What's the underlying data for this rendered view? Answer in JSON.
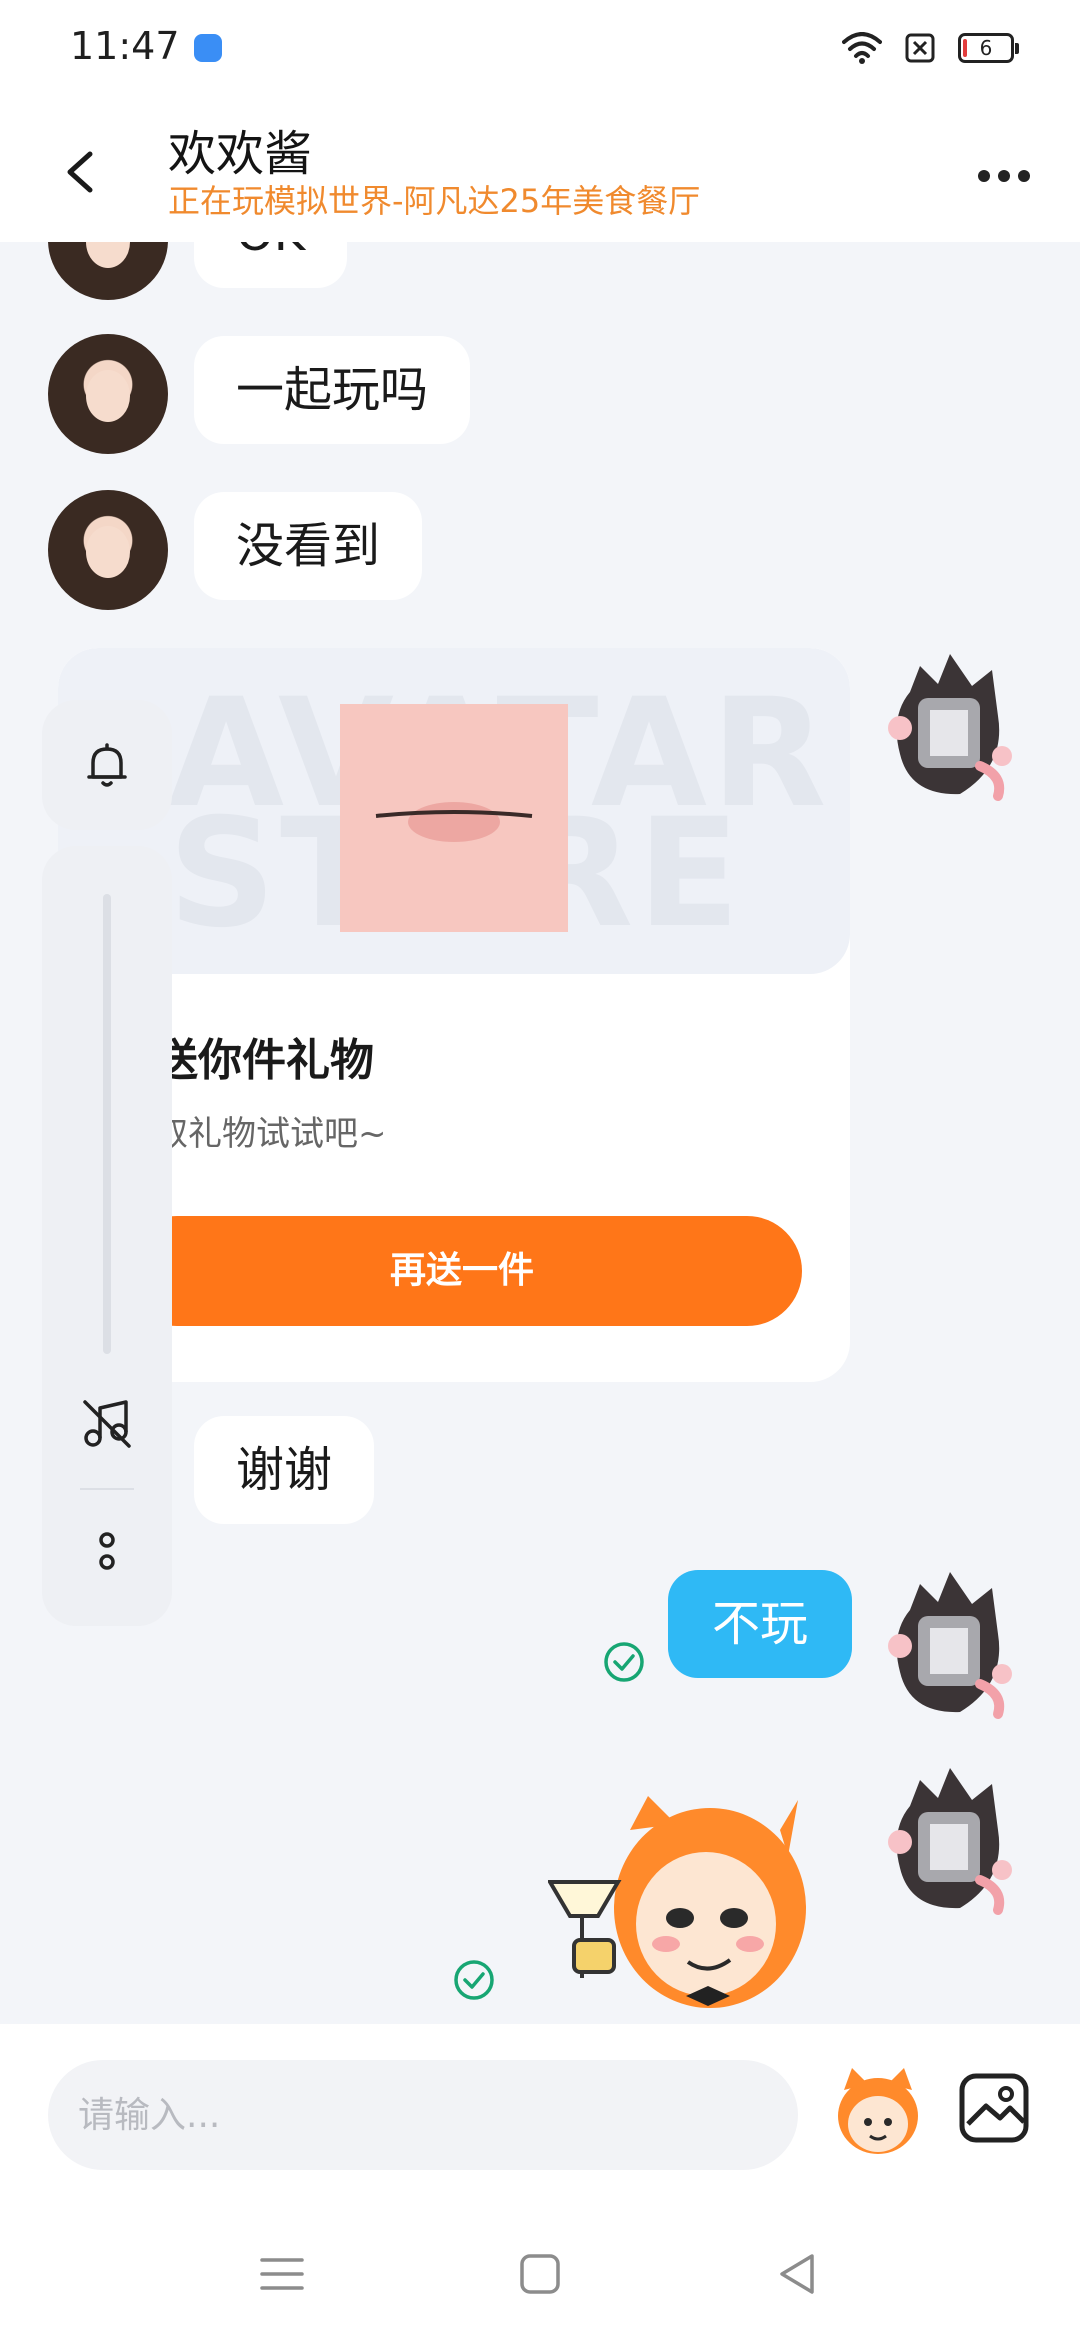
{
  "status_bar": {
    "time": "11:47",
    "battery_level": "6",
    "icons": [
      "wifi-icon",
      "sim-off-icon",
      "battery-icon"
    ]
  },
  "header": {
    "title": "欢欢酱",
    "subtitle": "正在玩模拟世界-阿凡达25年美食餐厅",
    "back_icon": "chevron-left-icon",
    "more_icon": "more-horizontal-icon"
  },
  "messages": [
    {
      "direction": "in",
      "text": "OK"
    },
    {
      "direction": "in",
      "text": "一起玩吗"
    },
    {
      "direction": "in",
      "text": "没看到"
    },
    {
      "direction": "out",
      "type": "gift"
    },
    {
      "direction": "in",
      "text": "谢谢"
    },
    {
      "direction": "out",
      "text": "不玩",
      "status": "check-circle-icon"
    },
    {
      "direction": "out",
      "type": "sticker",
      "status": "check-circle-icon"
    }
  ],
  "gift_card": {
    "watermark": "AVATAR STORE",
    "title": "送你件礼物",
    "description": "取礼物试试吧~",
    "button_label": "再送一件"
  },
  "side_panel": {
    "icons": [
      "bell-icon",
      "music-off-icon",
      "more-vertical-icon"
    ]
  },
  "input": {
    "placeholder": "请输入...",
    "value": "",
    "emoji_icon": "emoji-mascot-icon",
    "image_icon": "image-icon"
  },
  "nav": {
    "icons": [
      "menu-icon",
      "home-square-icon",
      "back-triangle-icon"
    ]
  },
  "colors": {
    "accent_orange": "#ff7618",
    "subtitle_orange": "#f08a2e",
    "outgoing_bubble": "#2fb9f5",
    "check_green": "#17a673",
    "background": "#f3f5f9"
  }
}
